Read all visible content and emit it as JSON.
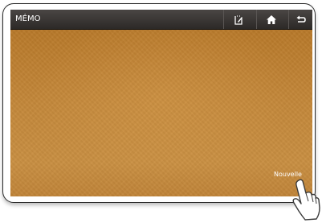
{
  "app": {
    "title": "MÉMO"
  },
  "toolbar": {
    "buttons": [
      {
        "icon": "memo-edit-icon"
      },
      {
        "icon": "home-icon"
      },
      {
        "icon": "back-arrow-icon"
      }
    ]
  },
  "memo": {
    "new_label": "Nouvelle"
  },
  "colors": {
    "title_bar": "#2c2927",
    "memo_background": "#c0842f",
    "text": "#ffffff"
  }
}
